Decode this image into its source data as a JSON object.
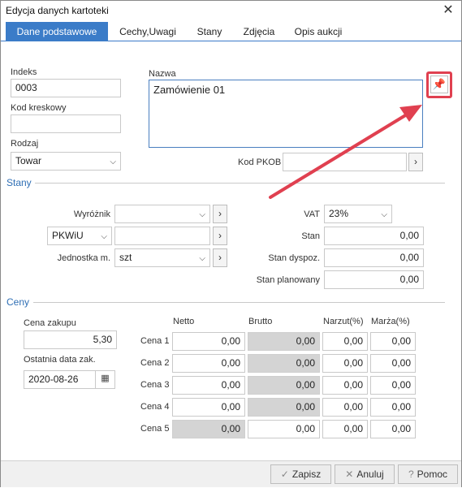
{
  "window": {
    "title": "Edycja danych kartoteki",
    "close_glyph": "✕"
  },
  "tabs": [
    {
      "label": "Dane podstawowe"
    },
    {
      "label": "Cechy,Uwagi"
    },
    {
      "label": "Stany"
    },
    {
      "label": "Zdjęcia"
    },
    {
      "label": "Opis aukcji"
    }
  ],
  "basic": {
    "indeks_label": "Indeks",
    "indeks_value": "0003",
    "kod_kreskowy_label": "Kod kreskowy",
    "kod_kreskowy_value": "",
    "rodzaj_label": "Rodzaj",
    "rodzaj_value": "Towar",
    "nazwa_label": "Nazwa",
    "nazwa_value": "Zamówienie 01",
    "kod_pkob_label": "Kod PKOB",
    "kod_pkob_value": ""
  },
  "stany": {
    "section_title": "Stany",
    "wyroznik_label": "Wyróżnik",
    "wyroznik_value": "",
    "pkwiu_label": "PKWiU",
    "pkwiu_value": "",
    "jednostka_label": "Jednostka m.",
    "jednostka_value": "szt",
    "vat_label": "VAT",
    "vat_value": "23%",
    "stan_label": "Stan",
    "stan_value": "0,00",
    "stan_dyspoz_label": "Stan dyspoz.",
    "stan_dyspoz_value": "0,00",
    "stan_planowany_label": "Stan planowany",
    "stan_planowany_value": "0,00"
  },
  "ceny": {
    "section_title": "Ceny",
    "cena_zakupu_label": "Cena zakupu",
    "cena_zakupu_value": "5,30",
    "ostatnia_data_label": "Ostatnia data zak.",
    "ostatnia_data_value": "2020-08-26",
    "columns": [
      "Netto",
      "Brutto",
      "Narzut(%)",
      "Marża(%)"
    ],
    "rows": [
      {
        "label": "Cena 1",
        "netto": "0,00",
        "brutto": "0,00",
        "narzut": "0,00",
        "marza": "0,00"
      },
      {
        "label": "Cena 2",
        "netto": "0,00",
        "brutto": "0,00",
        "narzut": "0,00",
        "marza": "0,00"
      },
      {
        "label": "Cena 3",
        "netto": "0,00",
        "brutto": "0,00",
        "narzut": "0,00",
        "marza": "0,00"
      },
      {
        "label": "Cena 4",
        "netto": "0,00",
        "brutto": "0,00",
        "narzut": "0,00",
        "marza": "0,00"
      },
      {
        "label": "Cena 5",
        "netto": "0,00",
        "brutto": "0,00",
        "narzut": "0,00",
        "marza": "0,00"
      }
    ]
  },
  "footer": {
    "save_label": "Zapisz",
    "cancel_label": "Anuluj",
    "help_label": "Pomoc"
  },
  "icons": {
    "pin": "pin-icon",
    "arrow_button": "chevron-right-icon",
    "calendar": "calendar-icon",
    "dropdown": "chevron-down-icon"
  },
  "colors": {
    "accent": "#3b7cc8",
    "highlight": "#e04050",
    "disabled_field": "#d4d4d4"
  }
}
